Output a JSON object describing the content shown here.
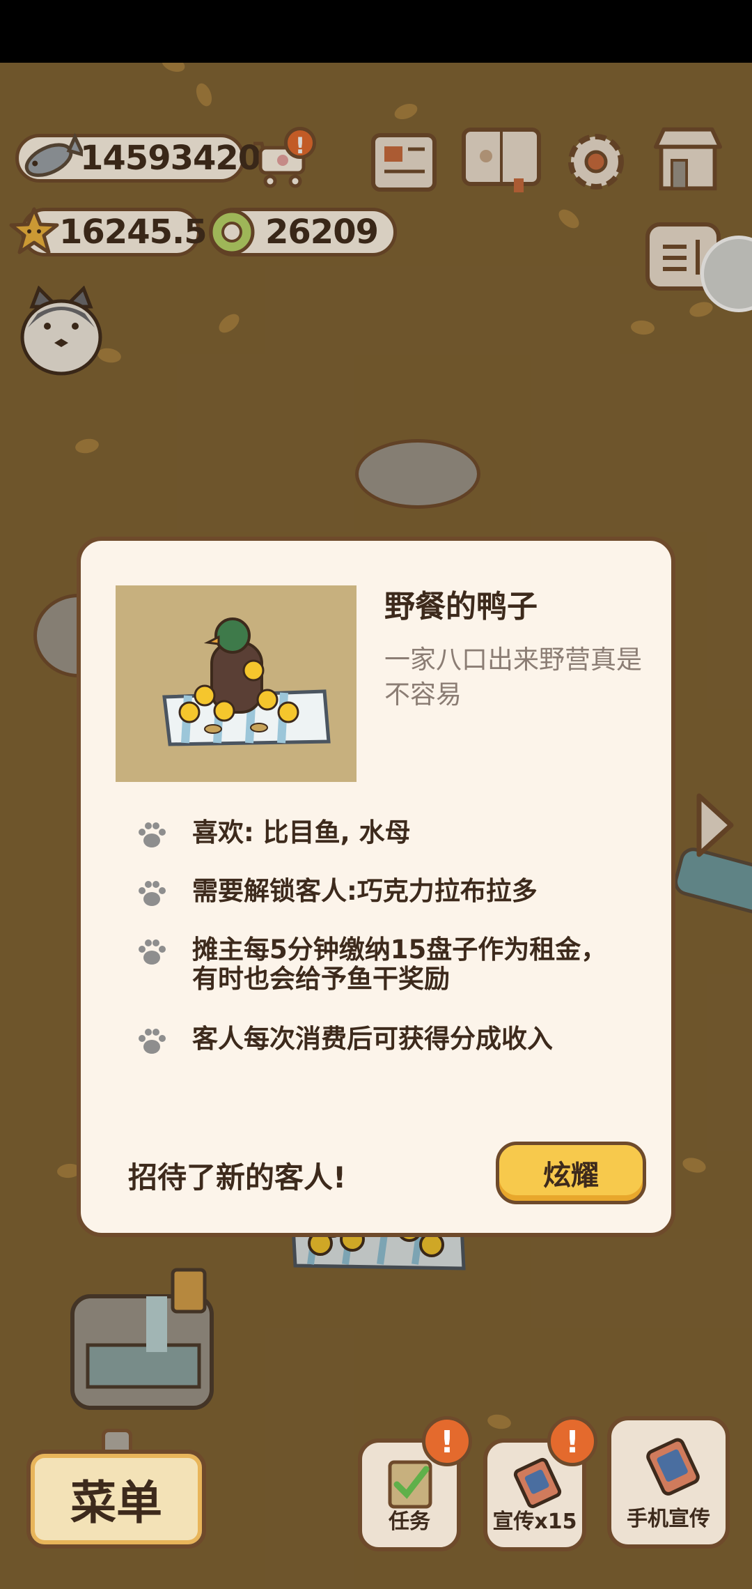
{
  "hud": {
    "fish_count": "14593420",
    "star_count": "16245.5",
    "ring_count": "26209",
    "alert_symbol": "!"
  },
  "dialog": {
    "title": "野餐的鸭子",
    "description": "一家八口出来野营真是不容易",
    "info": [
      "喜欢: 比目鱼, 水母",
      "需要解锁客人:巧克力拉布拉多",
      "摊主每5分钟缴纳15盘子作为租金，有时也会给予鱼干奖励",
      "客人每次消费后可获得分成收入"
    ],
    "footer_text": "招待了新的客人!",
    "share_label": "炫耀"
  },
  "bottom": {
    "menu_label": "菜单",
    "tasks_label": "任务",
    "promo_label": "宣传x15",
    "phone_promo_label": "手机宣传"
  },
  "colors": {
    "background": "#7e6233",
    "outline": "#6e4a2b",
    "panel": "#fcf4ea",
    "accent_yellow": "#f7c94c",
    "alert": "#e46a2d"
  }
}
